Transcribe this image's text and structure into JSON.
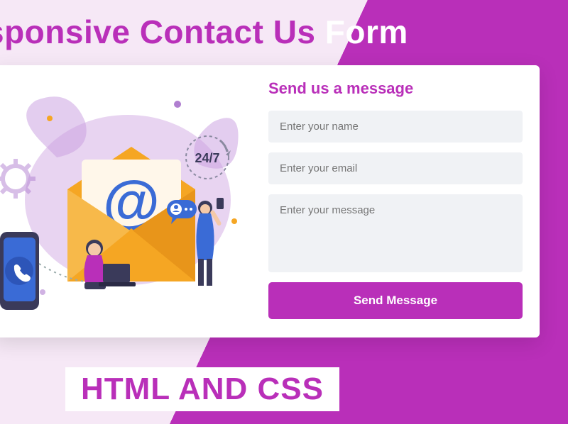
{
  "hero": {
    "part1": "sponsive Contact Us ",
    "part2": "Form"
  },
  "form": {
    "title": "Send us a message",
    "name_placeholder": "Enter your name",
    "email_placeholder": "Enter your email",
    "message_placeholder": "Enter your message",
    "submit_label": "Send Message"
  },
  "footer": {
    "tag": "HTML AND CSS"
  },
  "illustration": {
    "badge_text": "24/7",
    "at_symbol": "@"
  },
  "colors": {
    "accent": "#b92fb9",
    "bg_light": "#f6e8f6",
    "field_bg": "#f0f2f5"
  }
}
